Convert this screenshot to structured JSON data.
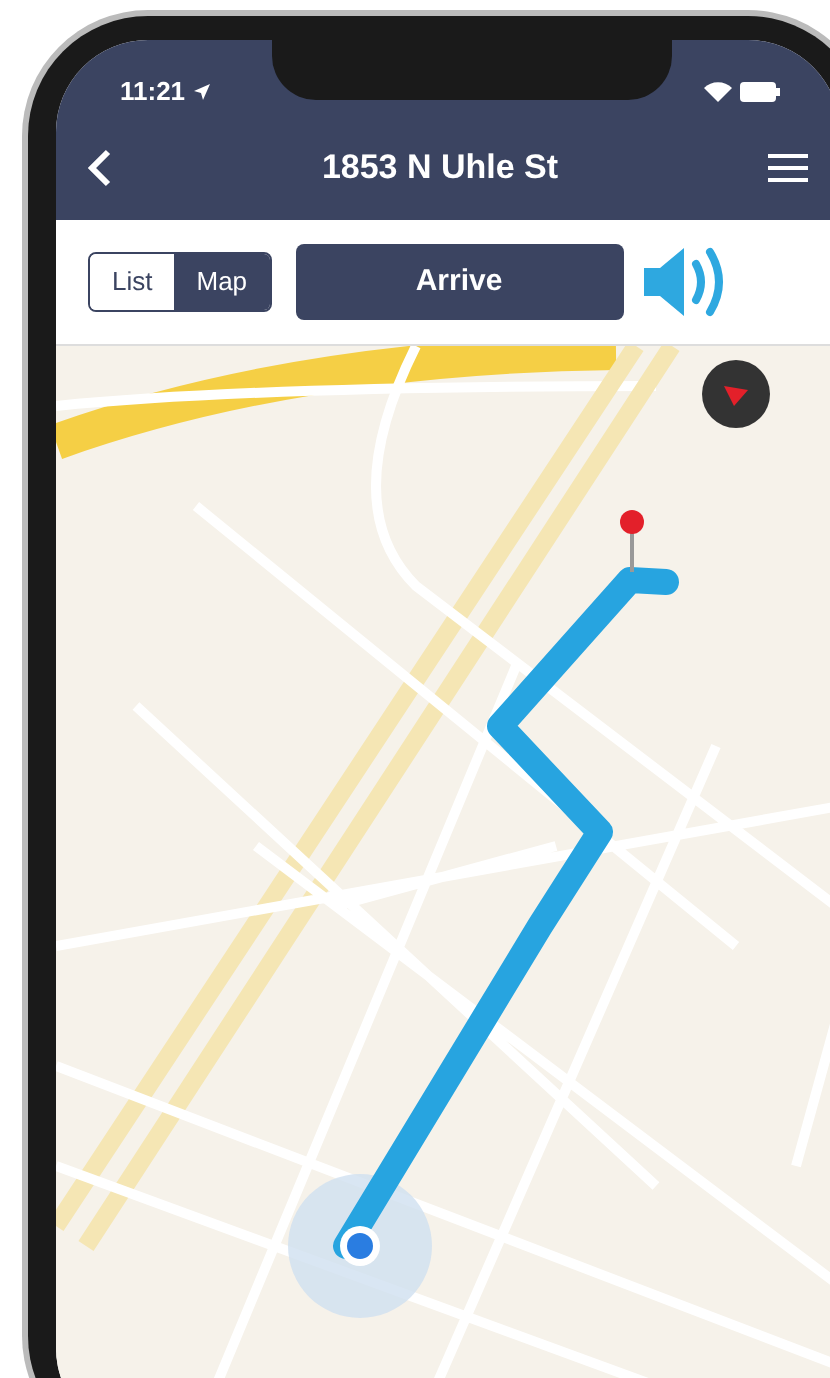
{
  "status_bar": {
    "time": "11:21"
  },
  "nav": {
    "title": "1853 N Uhle St"
  },
  "view_toggle": [
    {
      "label": "List",
      "selected": false
    },
    {
      "label": "Map",
      "selected": true
    }
  ],
  "action_button": {
    "label": "Arrive"
  }
}
